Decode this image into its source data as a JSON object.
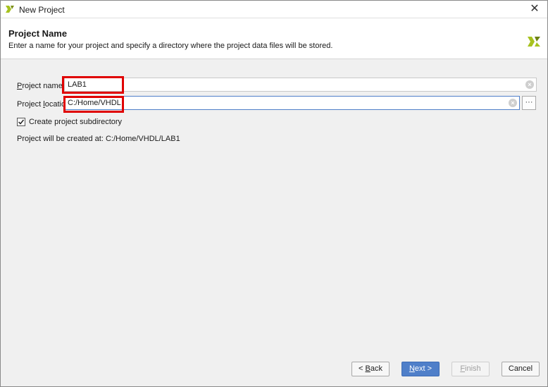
{
  "window": {
    "title": "New Project",
    "close_glyph": "✕"
  },
  "header": {
    "title": "Project Name",
    "description": "Enter a name for your project and specify a directory where the project data files will be stored."
  },
  "form": {
    "project_name": {
      "label_prefix": "",
      "label_mnemonic": "P",
      "label_rest": "roject name:",
      "value": "LAB1"
    },
    "project_location": {
      "label_prefix": "Project ",
      "label_mnemonic": "l",
      "label_rest": "ocation:",
      "value": "C:/Home/VHDL",
      "browse_label": "···"
    },
    "create_subdirectory": {
      "label": "Create project subdirectory",
      "checked": true
    },
    "created_at": {
      "label": "Project will be created at:",
      "path": "C:/Home/VHDL/LAB1"
    }
  },
  "footer": {
    "back": {
      "prefix": "< ",
      "mnemonic": "B",
      "rest": "ack"
    },
    "next": {
      "mnemonic": "N",
      "rest": "ext >"
    },
    "finish": {
      "mnemonic": "F",
      "rest": "inish"
    },
    "cancel": {
      "label": "Cancel"
    }
  },
  "colors": {
    "primary_button": "#4f7fc9",
    "highlight": "#e00000",
    "logo": "#a7c21f"
  },
  "icons": {
    "app": "vivado-logo-icon",
    "clear": "clear-field-icon",
    "check": "checkmark-icon"
  }
}
